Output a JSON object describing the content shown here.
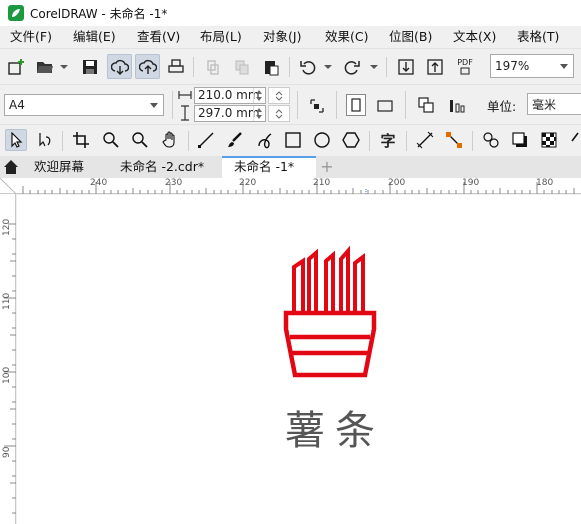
{
  "window": {
    "title": "CorelDRAW - 未命名 -1*"
  },
  "menu": [
    {
      "label": "文件(F)"
    },
    {
      "label": "编辑(E)"
    },
    {
      "label": "查看(V)"
    },
    {
      "label": "布局(L)"
    },
    {
      "label": "对象(J)"
    },
    {
      "label": "效果(C)"
    },
    {
      "label": "位图(B)"
    },
    {
      "label": "文本(X)"
    },
    {
      "label": "表格(T)"
    }
  ],
  "toolbar": {
    "zoom_value": "197%",
    "pdf_label": "PDF"
  },
  "property_bar": {
    "page_size": "A4",
    "width": "210.0 mm",
    "height": "297.0 mm",
    "units_label": "单位:",
    "units_value": "毫米"
  },
  "tabs": [
    {
      "label": "欢迎屏幕"
    },
    {
      "label": "未命名 -2.cdr*"
    },
    {
      "label": "未命名 -1*"
    }
  ],
  "tab_add": "+",
  "ruler": {
    "h_ticks": [
      "240",
      "230",
      "220",
      "210",
      "200",
      "190",
      "180"
    ],
    "v_ticks": [
      "120",
      "110",
      "100",
      "90"
    ]
  },
  "canvas": {
    "text": "薯条",
    "artwork_icon": "french-fries-icon",
    "artwork_color": "#e30613",
    "text_color": "#555555"
  }
}
